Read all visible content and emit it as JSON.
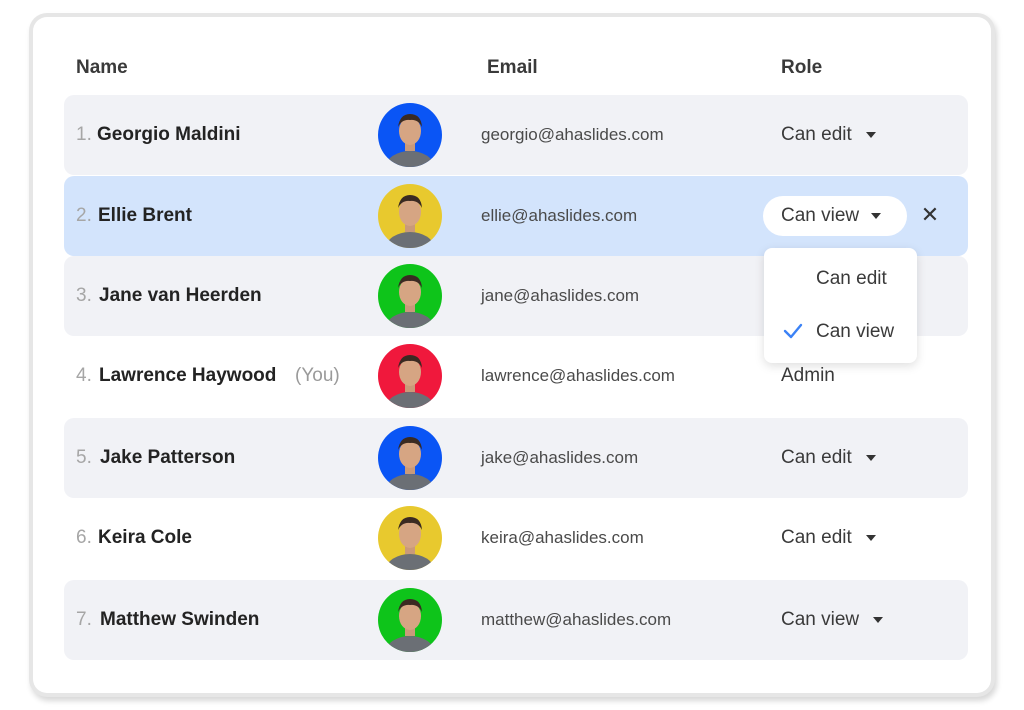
{
  "columns": {
    "name": "Name",
    "email": "Email",
    "role": "Role"
  },
  "members": [
    {
      "index": "1.",
      "name": "Georgio Maldini",
      "email": "georgio@ahaslides.com",
      "role": "Can edit",
      "avatar_bg": "#0a55f5",
      "shaded": true
    },
    {
      "index": "2.",
      "name": "Ellie Brent",
      "email": "ellie@ahaslides.com",
      "role": "Can view",
      "avatar_bg": "#e8c92e",
      "selected": true
    },
    {
      "index": "3.",
      "name": "Jane van Heerden",
      "email": "jane@ahaslides.com",
      "role": "",
      "avatar_bg": "#0ec41a",
      "shaded": true
    },
    {
      "index": "4.",
      "name": "Lawrence Haywood",
      "you_label": "(You)",
      "email": "lawrence@ahaslides.com",
      "role": "Admin",
      "avatar_bg": "#f0183c"
    },
    {
      "index": "5.",
      "name": "Jake Patterson",
      "email": "jake@ahaslides.com",
      "role": "Can edit",
      "avatar_bg": "#0a55f5",
      "shaded": true
    },
    {
      "index": "6.",
      "name": "Keira Cole",
      "email": "keira@ahaslides.com",
      "role": "Can edit",
      "avatar_bg": "#e8c92e"
    },
    {
      "index": "7.",
      "name": "Matthew Swinden",
      "email": "matthew@ahaslides.com",
      "role": "Can view",
      "avatar_bg": "#0ec41a",
      "shaded": true
    }
  ],
  "role_menu": {
    "options": [
      "Can edit",
      "Can view"
    ],
    "selected": "Can view"
  },
  "icons": {
    "remove": "close-icon",
    "dropdown": "caret-down-icon",
    "selected": "check-icon"
  },
  "colors": {
    "row_shaded": "#f1f2f6",
    "row_selected": "#d3e4fc",
    "check": "#3b82f6"
  }
}
